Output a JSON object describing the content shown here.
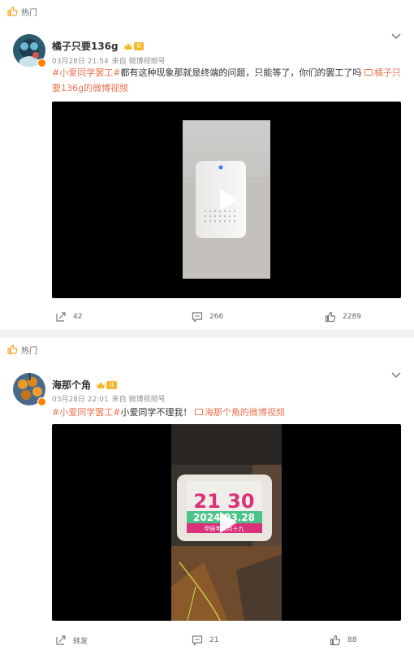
{
  "posts": [
    {
      "hot_label": "热门",
      "username": "橘子只要136g",
      "level": "II",
      "date": "03月28日 21:54",
      "source": "来自 微博视频号",
      "hashtag": "#小爱同学罢工#",
      "text": "都有这种现象那就是终端的问题，只能等了，你们的罢工了吗",
      "video_link": "橘子只要136g的微博视频",
      "repost_count": "42",
      "comment_count": "266",
      "like_count": "2289"
    },
    {
      "hot_label": "热门",
      "username": "海那个角",
      "level": "II",
      "date": "03月28日 22:01",
      "source": "来自 微博视频号",
      "hashtag": "#小爱同学罢工#",
      "text": "小爱同学不理我！",
      "video_link": "海那个角的微博视频",
      "repost_label": "转发",
      "comment_count": "21",
      "like_count": "88",
      "screen_time": "21 30",
      "screen_date": "2024.03.28",
      "screen_lunar": "甲辰年二月十九"
    }
  ],
  "colors": {
    "accent": "#eb7350",
    "badge": "#f5b82e",
    "verified": "#ff8200"
  }
}
